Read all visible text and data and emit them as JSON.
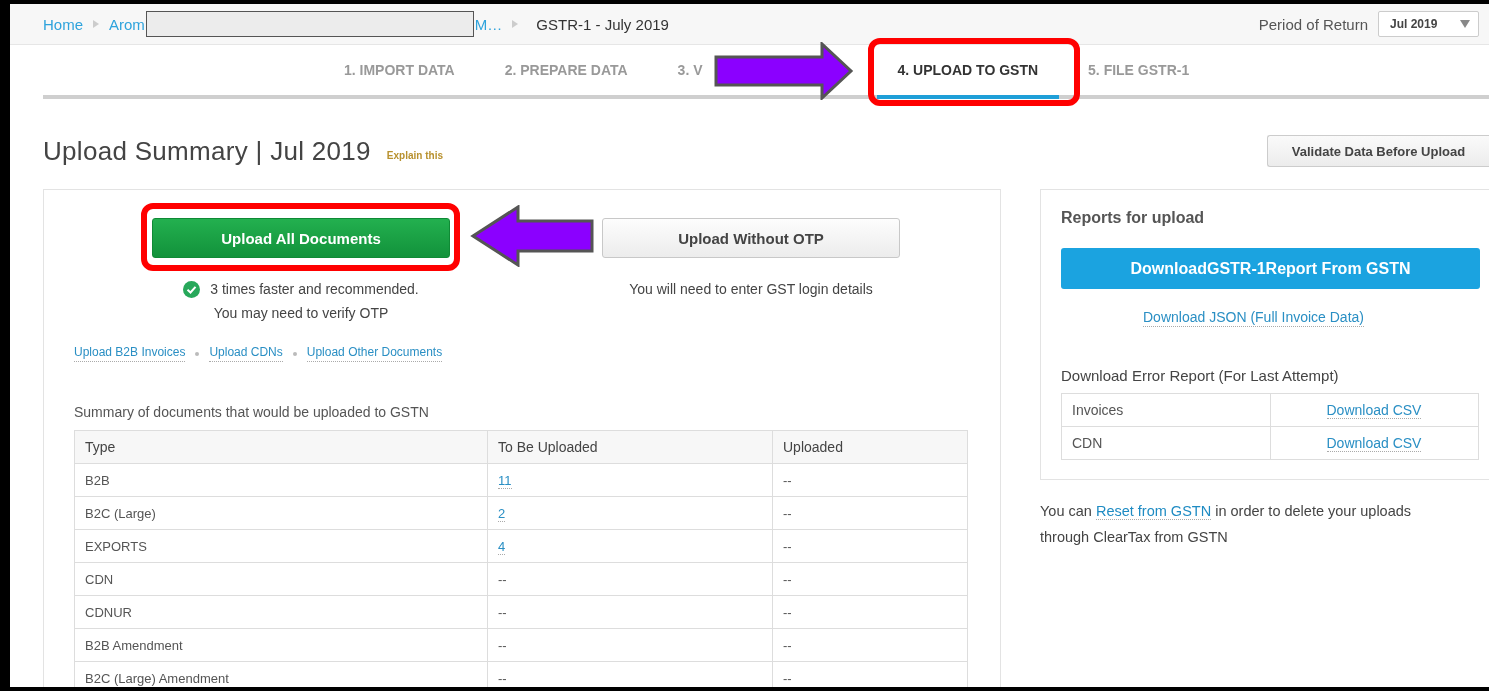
{
  "breadcrumb": {
    "items": [
      {
        "label": "Home"
      },
      {
        "label": "Arom"
      },
      {
        "label": "M…"
      }
    ],
    "current": "GSTR-1 - July 2019"
  },
  "period": {
    "label": "Period of Return",
    "value": "Jul 2019"
  },
  "steps": [
    {
      "label": "1. IMPORT DATA",
      "selected": false
    },
    {
      "label": "2. PREPARE DATA",
      "selected": false
    },
    {
      "label": "3. V",
      "selected": false
    },
    {
      "label": "4. UPLOAD TO GSTN",
      "selected": true
    },
    {
      "label": "5. FILE GSTR-1",
      "selected": false
    }
  ],
  "title": "Upload Summary | Jul 2019",
  "explain_link": "Explain this",
  "validate_button": "Validate Data Before Upload",
  "upload_options": [
    {
      "button": "Upload All Documents",
      "kind": "primary",
      "recommended": true,
      "notes": [
        "3 times faster and recommended.",
        "You may need to verify OTP"
      ]
    },
    {
      "button": "Upload Without OTP",
      "kind": "secondary",
      "recommended": false,
      "notes": [
        "You will need to enter GST login details"
      ]
    }
  ],
  "upload_links": [
    "Upload B2B Invoices",
    "Upload CDNs",
    "Upload Other Documents"
  ],
  "summary": {
    "caption": "Summary of documents that would be uploaded to GSTN",
    "columns": [
      "Type",
      "To Be Uploaded",
      "Uploaded"
    ],
    "rows": [
      {
        "type": "B2B",
        "to_be_uploaded": "11",
        "link": true,
        "uploaded": "--"
      },
      {
        "type": "B2C (Large)",
        "to_be_uploaded": "2",
        "link": true,
        "uploaded": "--"
      },
      {
        "type": "EXPORTS",
        "to_be_uploaded": "4",
        "link": true,
        "uploaded": "--"
      },
      {
        "type": "CDN",
        "to_be_uploaded": "--",
        "link": false,
        "uploaded": "--"
      },
      {
        "type": "CDNUR",
        "to_be_uploaded": "--",
        "link": false,
        "uploaded": "--"
      },
      {
        "type": "B2B Amendment",
        "to_be_uploaded": "--",
        "link": false,
        "uploaded": "--"
      },
      {
        "type": "B2C (Large) Amendment",
        "to_be_uploaded": "--",
        "link": false,
        "uploaded": "--"
      }
    ]
  },
  "reports": {
    "title": "Reports for upload",
    "download_button": "DownloadGSTR-1Report From GSTN",
    "json_link": "Download JSON (Full Invoice Data)",
    "error_title": "Download Error Report (For Last Attempt)",
    "error_rows": [
      {
        "name": "Invoices",
        "link": "Download CSV"
      },
      {
        "name": "CDN",
        "link": "Download CSV"
      }
    ]
  },
  "reset_note": {
    "before": "You can",
    "link": "Reset from GSTN",
    "after": "in order to delete your uploads through ClearTax from GSTN"
  }
}
